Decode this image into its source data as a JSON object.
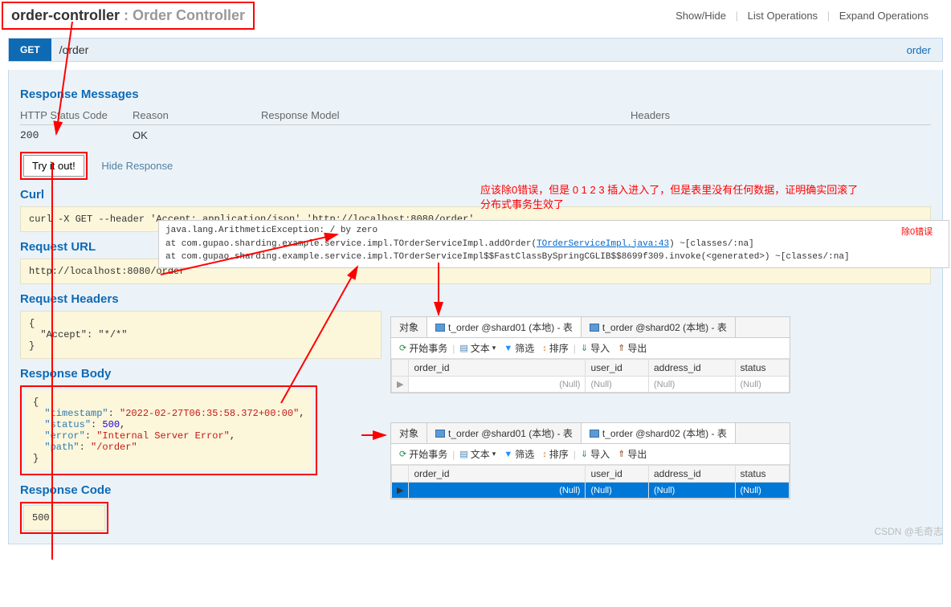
{
  "header": {
    "controller_bold": "order-controller",
    "controller_rest": " : Order Controller"
  },
  "ops": {
    "show_hide": "Show/Hide",
    "list": "List Operations",
    "expand": "Expand Operations"
  },
  "endpoint": {
    "method": "GET",
    "path": "/order",
    "link": "order"
  },
  "sections": {
    "resp_msgs": "Response Messages",
    "curl_t": "Curl",
    "req_url_t": "Request URL",
    "req_hdr_t": "Request Headers",
    "resp_body_t": "Response Body",
    "resp_code_t": "Response Code"
  },
  "cols": {
    "code": "HTTP Status Code",
    "reason": "Reason",
    "model": "Response Model",
    "headers": "Headers"
  },
  "row200": {
    "code": "200",
    "reason": "OK"
  },
  "try_btn": "Try it out!",
  "hide_resp": "Hide Response",
  "curl_cmd": "curl -X GET --header 'Accept: application/json' 'http://localhost:8080/order'",
  "req_url": "http://localhost:8080/order",
  "req_hdr": "{\n  \"Accept\": \"*/*\"\n}",
  "resp_body": {
    "timestamp": "2022-02-27T06:35:58.372+00:00",
    "status": 500,
    "error": "Internal Server Error",
    "path": "/order"
  },
  "resp_code": "500",
  "anno": {
    "line1": "应该除0错误，但是 0 1 2 3 插入进入了，但是表里没有任何数据，证明确实回滚了",
    "line2": "分布式事务生效了",
    "err_label": "除0错误"
  },
  "stack": {
    "l1": "java.lang.ArithmeticException: / by zero",
    "l2a": "    at com.gupao.sharding.example.service.impl.TOrderServiceImpl.addOrder(",
    "l2link": "TOrderServiceImpl.java:43",
    "l2b": ") ~[classes/:na]",
    "l3": "    at com.gupao.sharding.example.service.impl.TOrderServiceImpl$$FastClassBySpringCGLIB$$8699f309.invoke(<generated>) ~[classes/:na]"
  },
  "db": {
    "obj_tab": "对象",
    "tab_shard01": "t_order @shard01 (本地) - 表",
    "tab_shard02": "t_order @shard02 (本地) - 表",
    "tools": {
      "begin": "开始事务",
      "text": "文本",
      "filter": "筛选",
      "sort": "排序",
      "import": "导入",
      "export": "导出"
    },
    "cols": {
      "order_id": "order_id",
      "user_id": "user_id",
      "address_id": "address_id",
      "status": "status"
    },
    "null": "(Null)"
  },
  "watermark": "CSDN @毛奇志"
}
